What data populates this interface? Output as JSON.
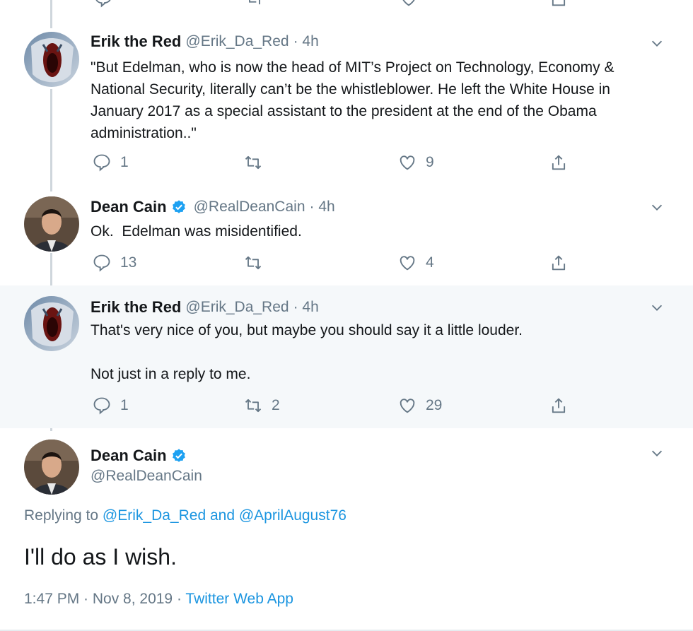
{
  "tweets": [
    {
      "name": "Erik the Red",
      "handle": "@Erik_Da_Red",
      "time": "· 4h",
      "text": "\"But Edelman, who is now the head of MIT’s Project on Technology, Economy & National Security, literally can’t be the whistleblower. He left the White House in January 2017 as a special assistant to the president at the end of the Obama administration..\"",
      "replies": "1",
      "retweets": "",
      "likes": "9"
    },
    {
      "name": "Dean Cain",
      "handle": "@RealDeanCain",
      "time": "· 4h",
      "text": "Ok.  Edelman was misidentified.",
      "replies": "13",
      "retweets": "",
      "likes": "4"
    },
    {
      "name": "Erik the Red",
      "handle": "@Erik_Da_Red",
      "time": "· 4h",
      "text": "That's very nice of you, but maybe you should say it a little louder.",
      "text2": "Not just in a reply to me.",
      "replies": "1",
      "retweets": "2",
      "likes": "29"
    }
  ],
  "focused": {
    "name": "Dean Cain",
    "handle": "@RealDeanCain",
    "replying_prefix": "Replying to",
    "replying_user1": "@Erik_Da_Red",
    "replying_and": "and",
    "replying_user2": "@AprilAugust76",
    "text": "I'll do as I wish.",
    "time": "1:47 PM · Nov 8, 2019 ·",
    "source": "Twitter Web App"
  },
  "colors": {
    "accent": "#1da1f2",
    "link": "#1b95e0",
    "muted": "#657786",
    "highlight_bg": "#f5f8fa"
  },
  "icons": [
    "reply-icon",
    "retweet-icon",
    "like-icon",
    "share-icon",
    "chevron-down-icon",
    "verified-badge-icon"
  ]
}
